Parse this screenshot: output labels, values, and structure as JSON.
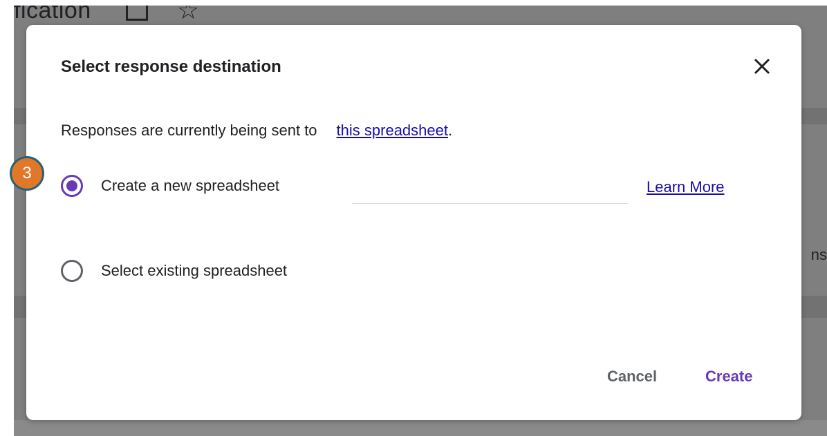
{
  "background": {
    "title_fragment": "fication",
    "side_text_fragment": "ns",
    "icons": [
      "folder-icon",
      "star-icon"
    ]
  },
  "dialog": {
    "title": "Select response destination",
    "close_icon": "close-icon",
    "info_prefix": "Responses are currently being sent to",
    "info_link": "this spreadsheet",
    "info_suffix": ".",
    "options": [
      {
        "label": "Create a new spreadsheet",
        "selected": true
      },
      {
        "label": "Select existing spreadsheet",
        "selected": false
      }
    ],
    "new_sheet_name_value": "",
    "learn_more": "Learn More",
    "cancel_label": "Cancel",
    "create_label": "Create"
  },
  "annotation": {
    "step_number": "3"
  },
  "colors": {
    "accent": "#673ab7",
    "link": "#1a0dab",
    "badge_fill": "#e0782a",
    "badge_border": "#2c5f78",
    "overlay": "#7f7f7f"
  }
}
